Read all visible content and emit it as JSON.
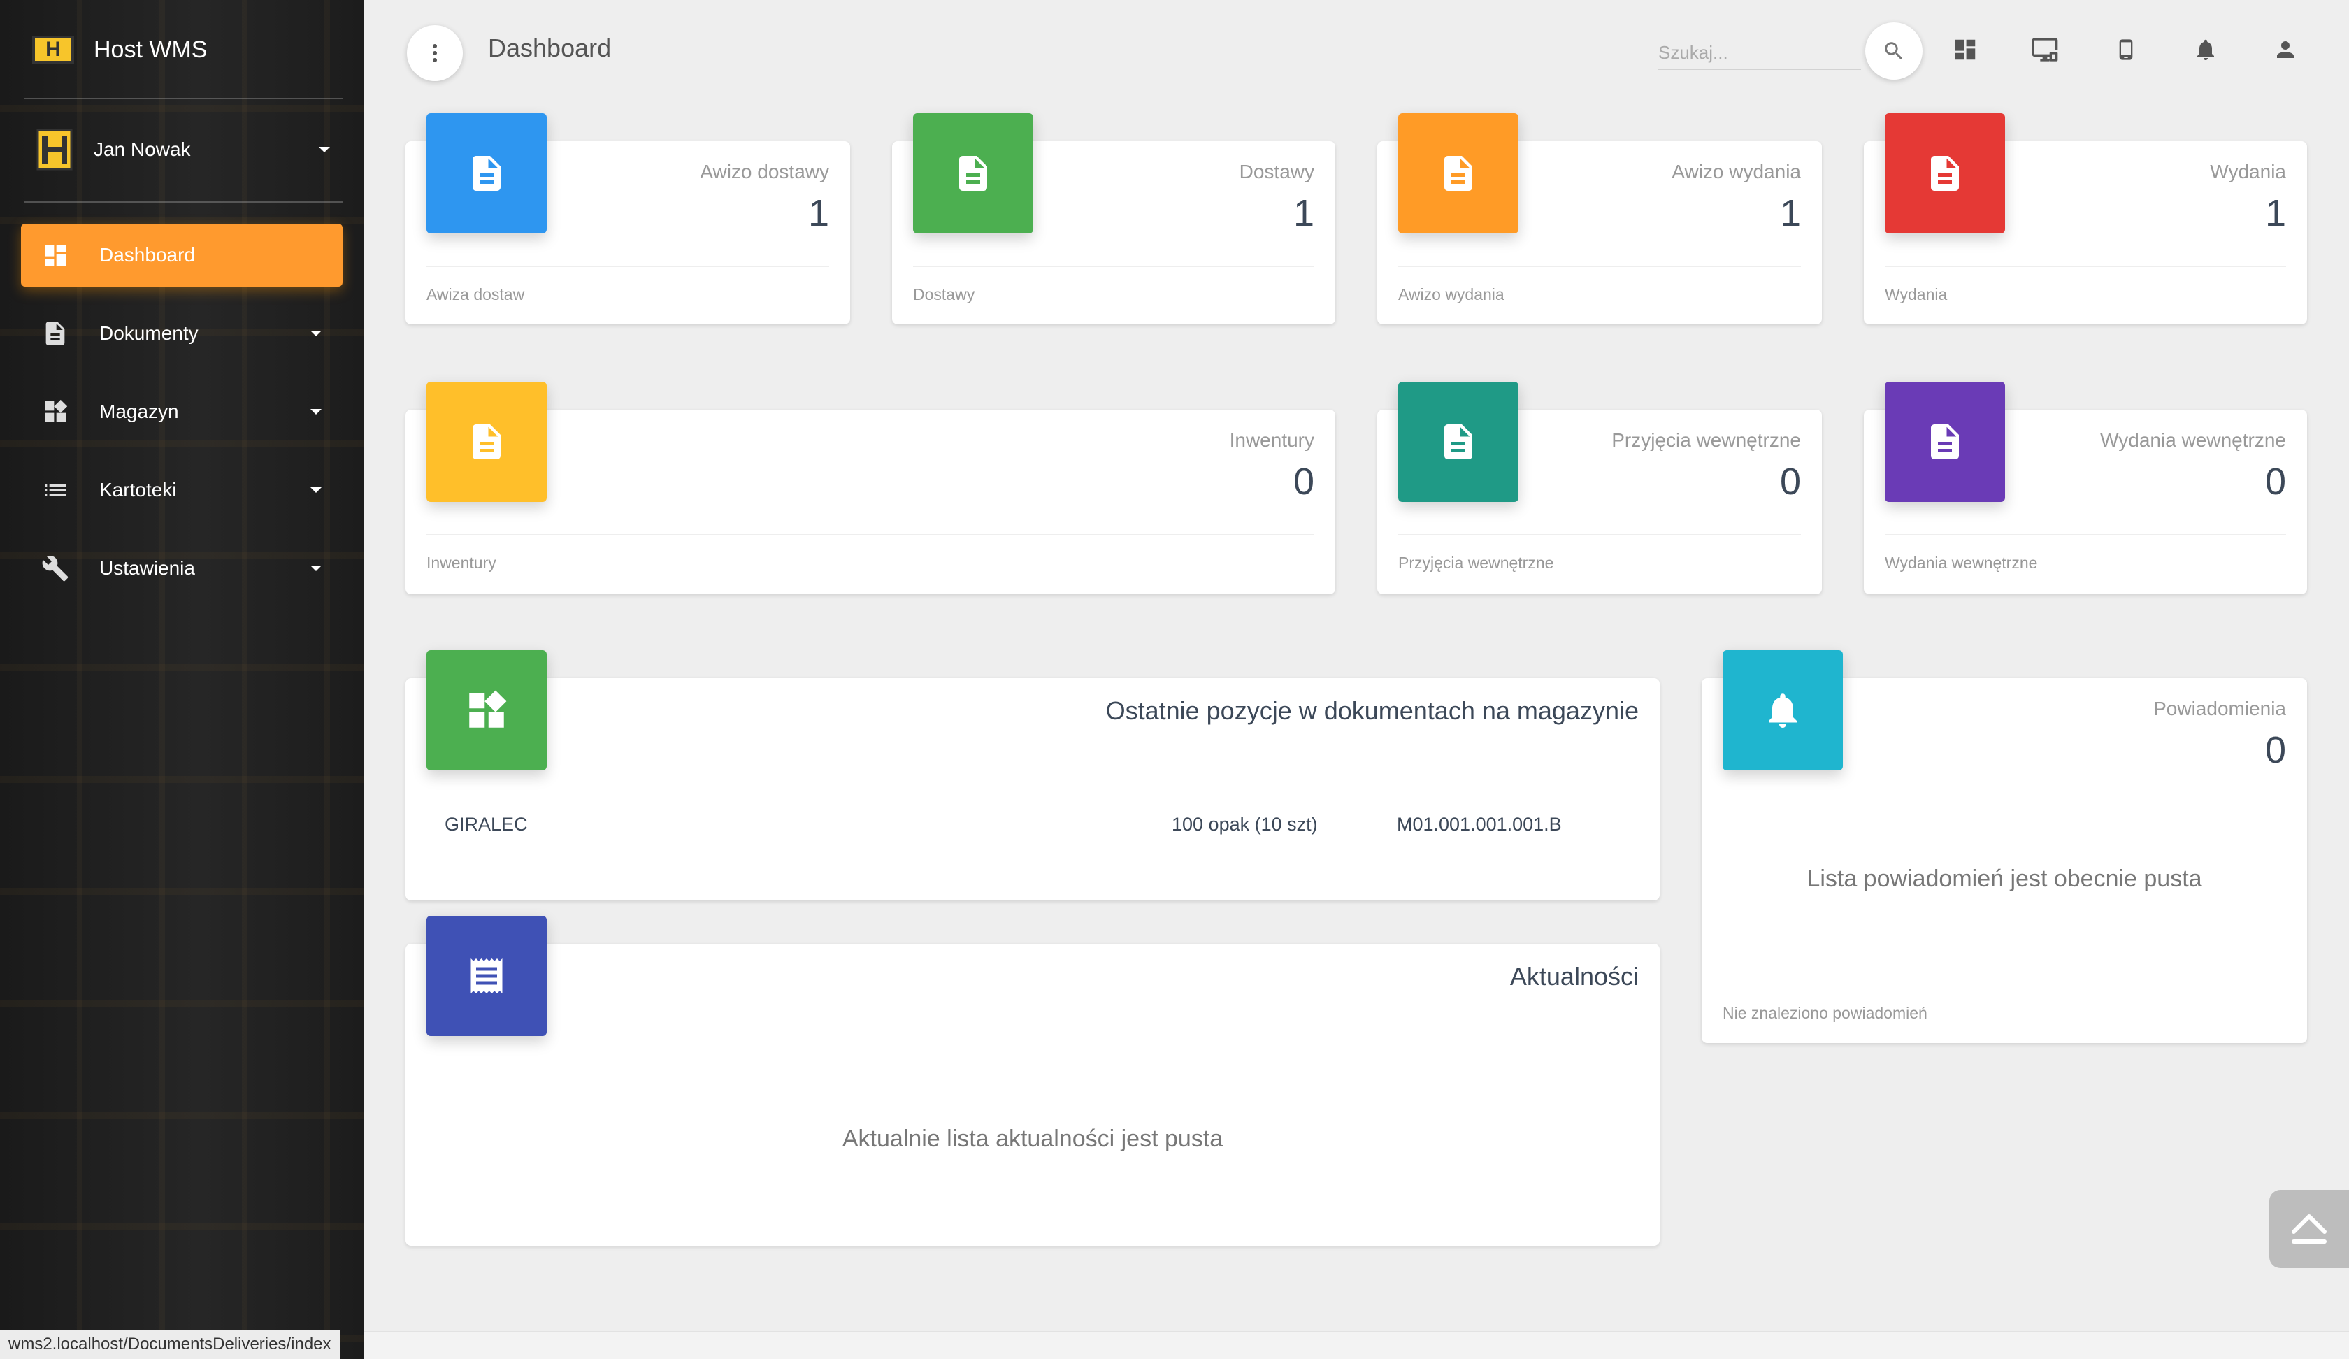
{
  "app": {
    "name": "Host WMS",
    "logo_letter": "H"
  },
  "user": {
    "name": "Jan Nowak"
  },
  "sidebar": {
    "items": [
      {
        "label": "Dashboard",
        "icon": "dashboard-icon",
        "active": true
      },
      {
        "label": "Dokumenty",
        "icon": "document-icon"
      },
      {
        "label": "Magazyn",
        "icon": "widgets-icon"
      },
      {
        "label": "Kartoteki",
        "icon": "list-icon"
      },
      {
        "label": "Ustawienia",
        "icon": "wrench-icon"
      }
    ]
  },
  "status_url": "wms2.localhost/DocumentsDeliveries/index",
  "topbar": {
    "title": "Dashboard",
    "search_placeholder": "Szukaj...",
    "icons": [
      "dashboard-icon",
      "desktop-icon",
      "phone-icon",
      "bell-icon",
      "person-icon"
    ]
  },
  "stats_row1": [
    {
      "category": "Awizo dostawy",
      "value": "1",
      "footer": "Awiza dostaw",
      "color": "#2e96f0"
    },
    {
      "category": "Dostawy",
      "value": "1",
      "footer": "Dostawy",
      "color": "#4caf50"
    },
    {
      "category": "Awizo wydania",
      "value": "1",
      "footer": "Awizo wydania",
      "color": "#ff9b26"
    },
    {
      "category": "Wydania",
      "value": "1",
      "footer": "Wydania",
      "color": "#e53935"
    }
  ],
  "stats_row2": [
    {
      "category": "Inwentury",
      "value": "0",
      "footer": "Inwentury",
      "color": "#ffbf2a"
    },
    {
      "category": "Przyjęcia wewnętrzne",
      "value": "0",
      "footer": "Przyjęcia wewnętrzne",
      "color": "#1f9a86"
    },
    {
      "category": "Wydania wewnętrzne",
      "value": "0",
      "footer": "Wydania wewnętrzne",
      "color": "#6a3bb6"
    }
  ],
  "recent_items": {
    "title": "Ostatnie pozycje w dokumentach na magazynie",
    "color": "#4caf50",
    "rows": [
      {
        "name": "GIRALEC",
        "qty": "100 opak (10 szt)",
        "location": "M01.001.001.001.B"
      }
    ]
  },
  "news": {
    "title": "Aktualności",
    "color": "#3f51b5",
    "empty": "Aktualnie lista aktualności jest pusta"
  },
  "notifications": {
    "category": "Powiadomienia",
    "value": "0",
    "empty": "Lista powiadomień jest obecnie pusta",
    "footer": "Nie znaleziono powiadomień",
    "color": "#1fb5cf"
  }
}
